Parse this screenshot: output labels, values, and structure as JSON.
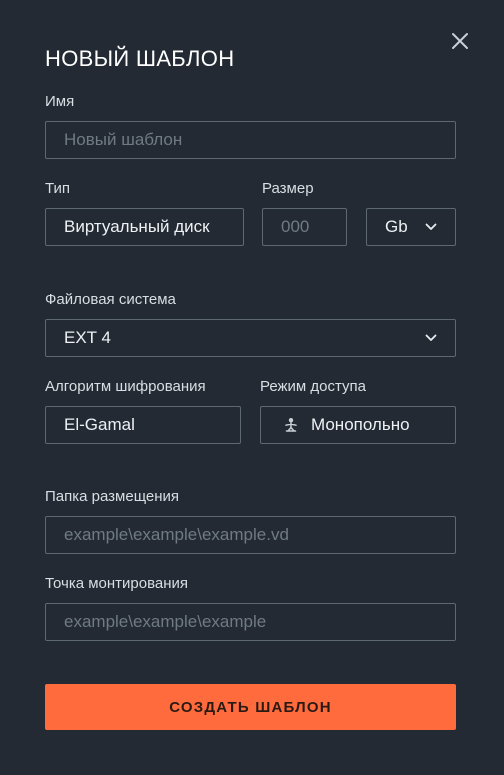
{
  "dialog": {
    "title": "НОВЫЙ ШАБЛОН",
    "close_icon": "close-icon"
  },
  "name": {
    "label": "Имя",
    "placeholder": "Новый шаблон"
  },
  "type": {
    "label": "Тип",
    "value": "Виртуальный диск"
  },
  "size": {
    "label": "Размер",
    "placeholder": "000",
    "unit": "Gb"
  },
  "filesystem": {
    "label": "Файловая система",
    "value": "EXT 4"
  },
  "encryption": {
    "label": "Алгоритм шифрования",
    "value": "El-Gamal"
  },
  "access": {
    "label": "Режим доступа",
    "value": "Монопольно",
    "icon": "person-icon"
  },
  "folder": {
    "label": "Папка размещения",
    "placeholder": "example\\example\\example.vd"
  },
  "mount": {
    "label": "Точка монтирования",
    "placeholder": "example\\example\\example"
  },
  "submit": {
    "label": "СОЗДАТЬ ШАБЛОН"
  },
  "colors": {
    "background": "#232a33",
    "accent": "#ff6b3c",
    "border": "#5e6872"
  }
}
